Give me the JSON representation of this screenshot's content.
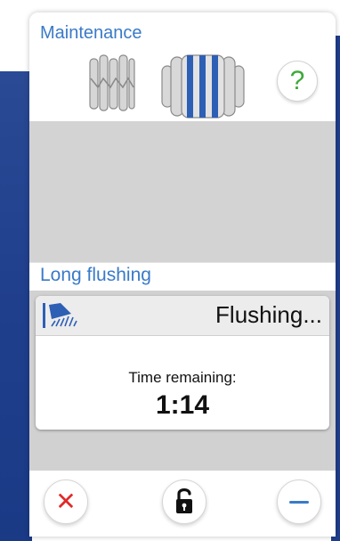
{
  "header": {
    "title": "Maintenance",
    "help_label": "?"
  },
  "section": {
    "title": "Long flushing"
  },
  "panel": {
    "status": "Flushing...",
    "time_label": "Time remaining:",
    "time_value": "1:14"
  },
  "footer": {
    "cancel_label": "✕"
  },
  "icons": {
    "filter": "filter-icon",
    "cartridge": "cartridge-icon",
    "shower": "shower-icon",
    "lock": "unlock-icon",
    "minus": "minus-icon"
  },
  "colors": {
    "accent": "#3a7ac8",
    "help": "#3fa93a",
    "cancel": "#e02a2a",
    "background": "#1f3e8c"
  }
}
